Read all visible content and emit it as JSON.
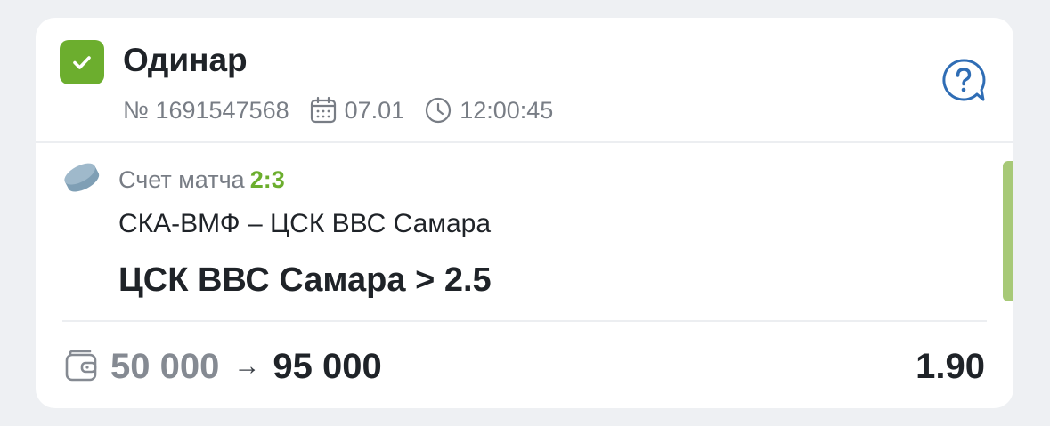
{
  "bet": {
    "type_label": "Одинар",
    "number": "№ 1691547568",
    "date": "07.01",
    "time": "12:00:45"
  },
  "event": {
    "score_label": "Счет матча",
    "score": "2:3",
    "teams": "СКА-ВМФ – ЦСК ВВС Самара",
    "outcome": "ЦСК ВВС Самара > 2.5"
  },
  "footer": {
    "stake": "50 000",
    "arrow": "→",
    "payout": "95 000",
    "coefficient": "1.90"
  },
  "icons": {
    "check": "check-icon",
    "calendar": "calendar-icon",
    "clock": "clock-icon",
    "help": "help-chat-icon",
    "sport": "hockey-puck-icon",
    "wallet": "wallet-icon"
  },
  "colors": {
    "accent_green": "#6cae2e",
    "help_blue": "#2f6db5",
    "status_bar": "#a7c977"
  }
}
